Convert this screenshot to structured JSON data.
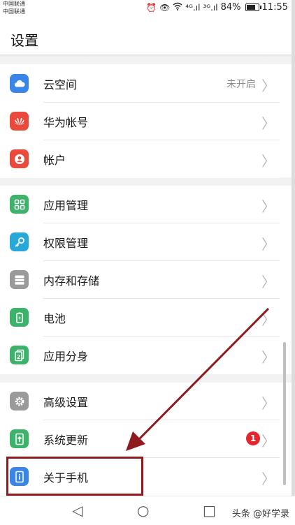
{
  "status_bar": {
    "carrier_1": "中国联通",
    "carrier_2": "中国联通",
    "signal_1": "⁴ᴳ.ıl",
    "signal_2": "³ᴳ.ıl",
    "battery_percent": "84%",
    "time": "11:55"
  },
  "header": {
    "title": "设置"
  },
  "sections": [
    {
      "items": [
        {
          "label": "云空间",
          "value": "未开启",
          "icon": "cloud-icon",
          "color": "#3a86e8"
        },
        {
          "label": "华为帐号",
          "icon": "huawei-logo-icon",
          "color": "#ea4a3c"
        },
        {
          "label": "帐户",
          "icon": "person-icon",
          "color": "#ea4a3c"
        }
      ]
    },
    {
      "items": [
        {
          "label": "应用管理",
          "icon": "app-grid-icon",
          "color": "#3cb26a"
        },
        {
          "label": "权限管理",
          "icon": "key-icon",
          "color": "#27a9d8"
        },
        {
          "label": "内存和存储",
          "icon": "storage-icon",
          "color": "#9a9a9a"
        },
        {
          "label": "电池",
          "icon": "battery-icon",
          "color": "#3cb26a"
        },
        {
          "label": "应用分身",
          "icon": "app-twin-icon",
          "color": "#3cb26a"
        }
      ]
    },
    {
      "items": [
        {
          "label": "高级设置",
          "icon": "gear-icon",
          "color": "#9a9a9a"
        },
        {
          "label": "系统更新",
          "badge": "1",
          "icon": "update-icon",
          "color": "#3cb26a"
        },
        {
          "label": "关于手机",
          "icon": "info-phone-icon",
          "color": "#3a86e8"
        }
      ]
    }
  ],
  "nav": {
    "back": "◁",
    "home": "○",
    "recents": "□"
  },
  "watermark": "头条 @好学录",
  "annotation_color": "#8e1a1e"
}
